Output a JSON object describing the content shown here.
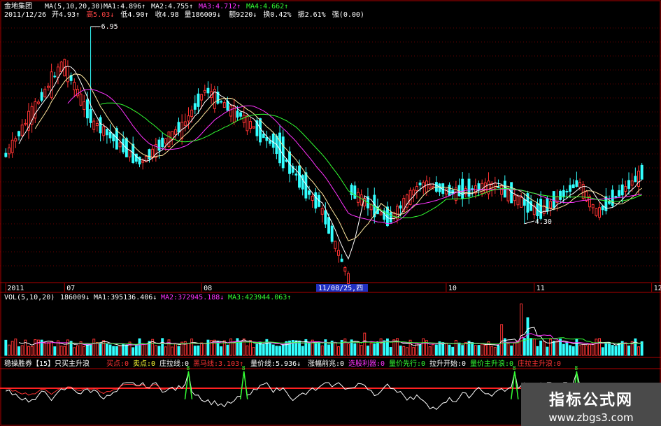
{
  "chart_data": [
    {
      "type": "candlestick",
      "stock_name": "金地集团",
      "ma_label": "MA(5,10,20,30)",
      "ma_values": [
        {
          "label": "MA1:4.896↑",
          "color": "#ffffff"
        },
        {
          "label": "MA2:4.755↑",
          "color": "#ffffff"
        },
        {
          "label": "MA3:4.712↑",
          "color": "#ff33ff"
        },
        {
          "label": "MA4:4.662↑",
          "color": "#33ff33"
        }
      ],
      "info": {
        "date": "2011/12/26",
        "open": "开4.93↑",
        "high": "高5.03↓",
        "low": "低4.90↑",
        "close": "收4.98",
        "vol": "量186009↓",
        "amount": "额9220↓",
        "turnover": "换0.42%",
        "amplitude": "振2.61%",
        "strength": "强(0.00)"
      },
      "annotations": [
        {
          "label": "6.95",
          "value": 6.95
        },
        {
          "label": "4.30",
          "value": 4.3
        }
      ],
      "ohlc_segments": [
        {
          "from": [
            5.25,
            5.2
          ],
          "to": [
            6.3,
            6.5
          ],
          "n": 18
        },
        {
          "from": [
            6.3,
            6.5
          ],
          "to": [
            5.7,
            5.6
          ],
          "n": 10
        },
        {
          "from": [
            5.7,
            5.6
          ],
          "to": [
            5.2,
            5.1
          ],
          "n": 14
        },
        {
          "from": [
            5.2,
            5.1
          ],
          "to": [
            5.55,
            5.6
          ],
          "n": 12
        },
        {
          "from": [
            5.55,
            5.6
          ],
          "to": [
            6.05,
            6.1
          ],
          "n": 8
        },
        {
          "from": [
            6.05,
            6.1
          ],
          "to": [
            5.7,
            5.8
          ],
          "n": 10
        },
        {
          "from": [
            5.7,
            5.8
          ],
          "to": [
            5.55,
            5.3
          ],
          "n": 10
        },
        {
          "from": [
            5.55,
            5.3
          ],
          "to": [
            4.65,
            4.55
          ],
          "n": 14
        },
        {
          "from": [
            4.65,
            4.55
          ],
          "to": [
            3.55,
            3.6
          ],
          "n": 10
        },
        {
          "from": [
            4.8,
            4.7
          ],
          "to": [
            4.4,
            4.35
          ],
          "n": 12
        },
        {
          "from": [
            4.4,
            4.35
          ],
          "to": [
            4.8,
            4.85
          ],
          "n": 10
        },
        {
          "from": [
            4.8,
            4.85
          ],
          "to": [
            4.75,
            4.7
          ],
          "n": 10
        },
        {
          "from": [
            4.75,
            4.7
          ],
          "to": [
            4.85,
            4.8
          ],
          "n": 12
        },
        {
          "from": [
            4.85,
            4.8
          ],
          "to": [
            4.5,
            4.45
          ],
          "n": 14
        },
        {
          "from": [
            4.5,
            4.45
          ],
          "to": [
            4.8,
            4.85
          ],
          "n": 12
        },
        {
          "from": [
            4.8,
            4.85
          ],
          "to": [
            4.5,
            4.45
          ],
          "n": 6
        },
        {
          "from": [
            4.5,
            4.45
          ],
          "to": [
            4.95,
            4.98
          ],
          "n": 14
        }
      ],
      "x_axis": {
        "ticks": [
          {
            "label": "2011",
            "i": 0
          },
          {
            "label": "07",
            "i": 18
          },
          {
            "label": "08",
            "i": 60
          },
          {
            "label": "10",
            "i": 135
          },
          {
            "label": "11",
            "i": 162
          },
          {
            "label": "12",
            "i": 198
          }
        ],
        "cursor_label": "11/08/25,四"
      }
    },
    {
      "type": "bar",
      "title": "VOL(5,10,20)",
      "value_label": "186009↓",
      "ma_values": [
        {
          "label": "MA1:395136.406↓",
          "color": "#ffffff"
        },
        {
          "label": "MA2:372945.188↓",
          "color": "#ff33ff"
        },
        {
          "label": "MA3:423944.063↑",
          "color": "#33ff33"
        }
      ],
      "spikes": [
        {
          "i": 158,
          "v": 3.0
        },
        {
          "i": 160,
          "v": 2.2
        },
        {
          "i": 152,
          "v": 1.8
        },
        {
          "i": 199,
          "v": 1.6
        },
        {
          "i": 110,
          "v": 1.3
        }
      ]
    },
    {
      "type": "line",
      "title": "稳操胜券【15】只买主升浪",
      "labels": [
        {
          "text": "买点:0",
          "color": "#ff3333"
        },
        {
          "text": "卖点:0",
          "color": "#ffff33"
        },
        {
          "text": "庄拉线:0",
          "color": "#ffffff"
        },
        {
          "text": "黑马线:3.103↑",
          "color": "#ff3333"
        },
        {
          "text": "量价线:5.936↓",
          "color": "#ffffff"
        },
        {
          "text": "涨幅前兆:0",
          "color": "#ffffff"
        },
        {
          "text": "选股利器:0",
          "color": "#ff33ff"
        },
        {
          "text": "量价先行:0",
          "color": "#33ff33"
        },
        {
          "text": "拉升开始:0",
          "color": "#ffffff"
        },
        {
          "text": "量价主升浪:0",
          "color": "#33ff33"
        },
        {
          "text": "庄拉主升浪:0",
          "color": "#ff3333"
        }
      ],
      "peaks": [
        {
          "i": 56,
          "label": "8"
        },
        {
          "i": 73,
          "label": "8"
        },
        {
          "i": 156,
          "label": "8"
        },
        {
          "i": 175,
          "label": "8"
        }
      ]
    }
  ],
  "watermark": {
    "title": "指标公式网",
    "url": "www.zbgs3.com"
  },
  "colors": {
    "up": "#ff3333",
    "down": "#33ffff",
    "frame": "#b00000",
    "grid": "#8b0000",
    "text": "#ffffff"
  }
}
